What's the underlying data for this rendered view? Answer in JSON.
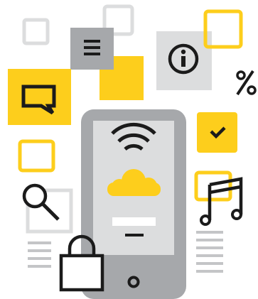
{
  "illustration": {
    "colors": {
      "yellow": "#FDCE1C",
      "light_gray": "#DCDDDE",
      "mid_gray": "#C4C5C7",
      "dark_gray": "#A6A8AB",
      "black": "#1B1B1B",
      "white": "#FFFFFF"
    },
    "icons": [
      "square-outline-icon",
      "menu-icon",
      "info-icon",
      "percent-icon",
      "chat-bubble-icon",
      "checkmark-icon",
      "search-icon",
      "music-note-icon",
      "lock-icon",
      "wifi-icon",
      "cloud-icon",
      "text-lines-icon",
      "smartphone"
    ]
  }
}
